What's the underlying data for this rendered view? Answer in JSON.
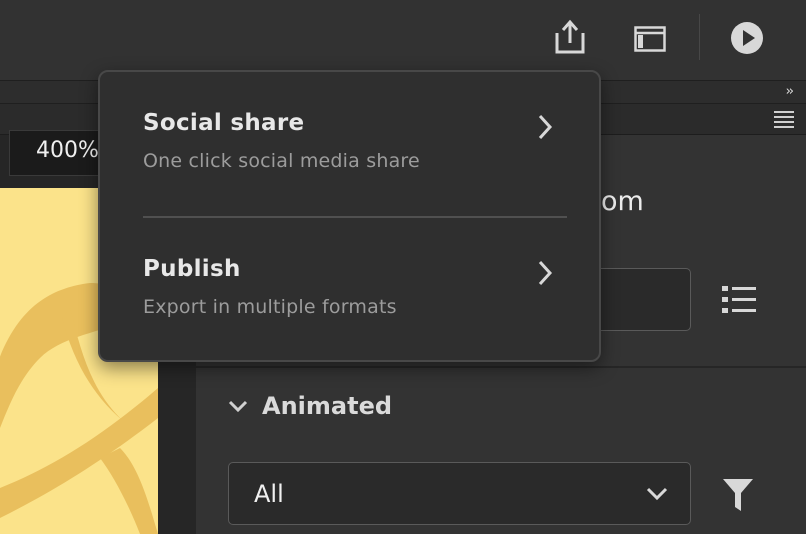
{
  "toolbar": {
    "share_icon": "share-icon",
    "panel_icon": "panel-layout-icon",
    "play_icon": "play-circle-icon"
  },
  "stage": {
    "zoom_value": "400%",
    "canvas_color": "#fbe38a"
  },
  "panel": {
    "heading_fragment": "om",
    "animated_label": "Animated",
    "filter_dropdown_value": "All"
  },
  "share_menu": {
    "items": [
      {
        "title": "Social share",
        "description": "One click social media share"
      },
      {
        "title": "Publish",
        "description": "Export in multiple formats"
      }
    ]
  },
  "colors": {
    "background": "#323232",
    "popover": "#2f2f2f",
    "canvas": "#fbe38a",
    "shape": "#e9bf5d"
  }
}
